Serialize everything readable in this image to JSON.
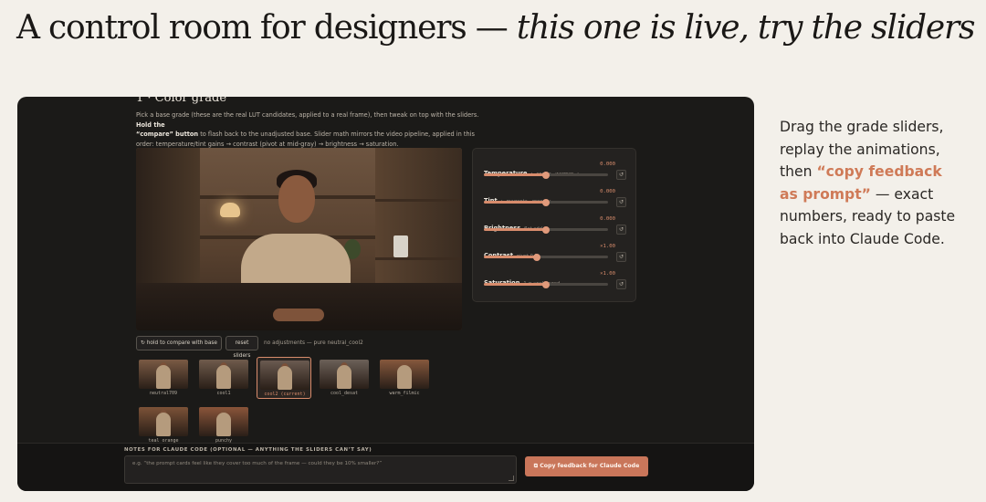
{
  "headline": {
    "plain": "A control room for designers — ",
    "italic": "this one is live, try the sliders"
  },
  "section": {
    "title": "1 · Color grade",
    "desc_1": "Pick a base grade (these are the real LUT candidates, applied to a real frame), then tweak on top with the sliders. ",
    "desc_bold_1": "Hold the",
    "desc_bold_2": "“compare” button",
    "desc_2": " to flash back to the unadjusted base. Slider math mirrors the video pipeline, applied in this order: temperature/tint gains → contrast (pivot at mid-gray) → brightness → saturation."
  },
  "sliders": [
    {
      "label": "Temperature",
      "hint": "← cooler · warmer →",
      "value": "0.000",
      "fraction": 0.5,
      "reset": "↺"
    },
    {
      "label": "Tint",
      "hint": "← magenta · green →",
      "value": "0.000",
      "fraction": 0.5,
      "reset": "↺"
    },
    {
      "label": "Brightness",
      "hint": "flat add",
      "value": "0.000",
      "fraction": 0.5,
      "reset": "↺"
    },
    {
      "label": "Contrast",
      "hint": "pivot 0.5",
      "value": "×1.00",
      "fraction": 0.43,
      "reset": "↺"
    },
    {
      "label": "Saturation",
      "hint": "1 = unchanged",
      "value": "×1.00",
      "fraction": 0.5,
      "reset": "↺"
    }
  ],
  "controls": {
    "compare": "↻ hold to compare with base",
    "reset": "reset sliders",
    "status": "no adjustments — pure neutral_cool2"
  },
  "grades": [
    {
      "label": "neutral709",
      "tone": "#7a5a44"
    },
    {
      "label": "cool1",
      "tone": "#6f5b4c"
    },
    {
      "label": "cool2 (current)",
      "tone": "#6a5a50",
      "current": true
    },
    {
      "label": "cool_desat",
      "tone": "#6b6058"
    },
    {
      "label": "warm_filmic",
      "tone": "#86583d"
    },
    {
      "label": "teal_orange",
      "tone": "#7c5238"
    },
    {
      "label": "punchy",
      "tone": "#8a553a"
    }
  ],
  "notes": {
    "label": "NOTES FOR CLAUDE CODE (OPTIONAL — ANYTHING THE SLIDERS CAN’T SAY)",
    "placeholder": "e.g. “the prompt cards feel like they cover too much of the frame — could they be 10% smaller?”",
    "copy_button": "⧉ Copy feedback for Claude Code"
  },
  "side": {
    "text_1": "Drag the grade sliders, replay the animations, then ",
    "highlight": "“copy feedback as prompt”",
    "text_2": " — exact numbers, ready to paste back into Claude Code."
  },
  "colors": {
    "accent": "#d88c6c",
    "panel_bg": "#1b1a18",
    "page_bg": "#f3f0ea"
  }
}
